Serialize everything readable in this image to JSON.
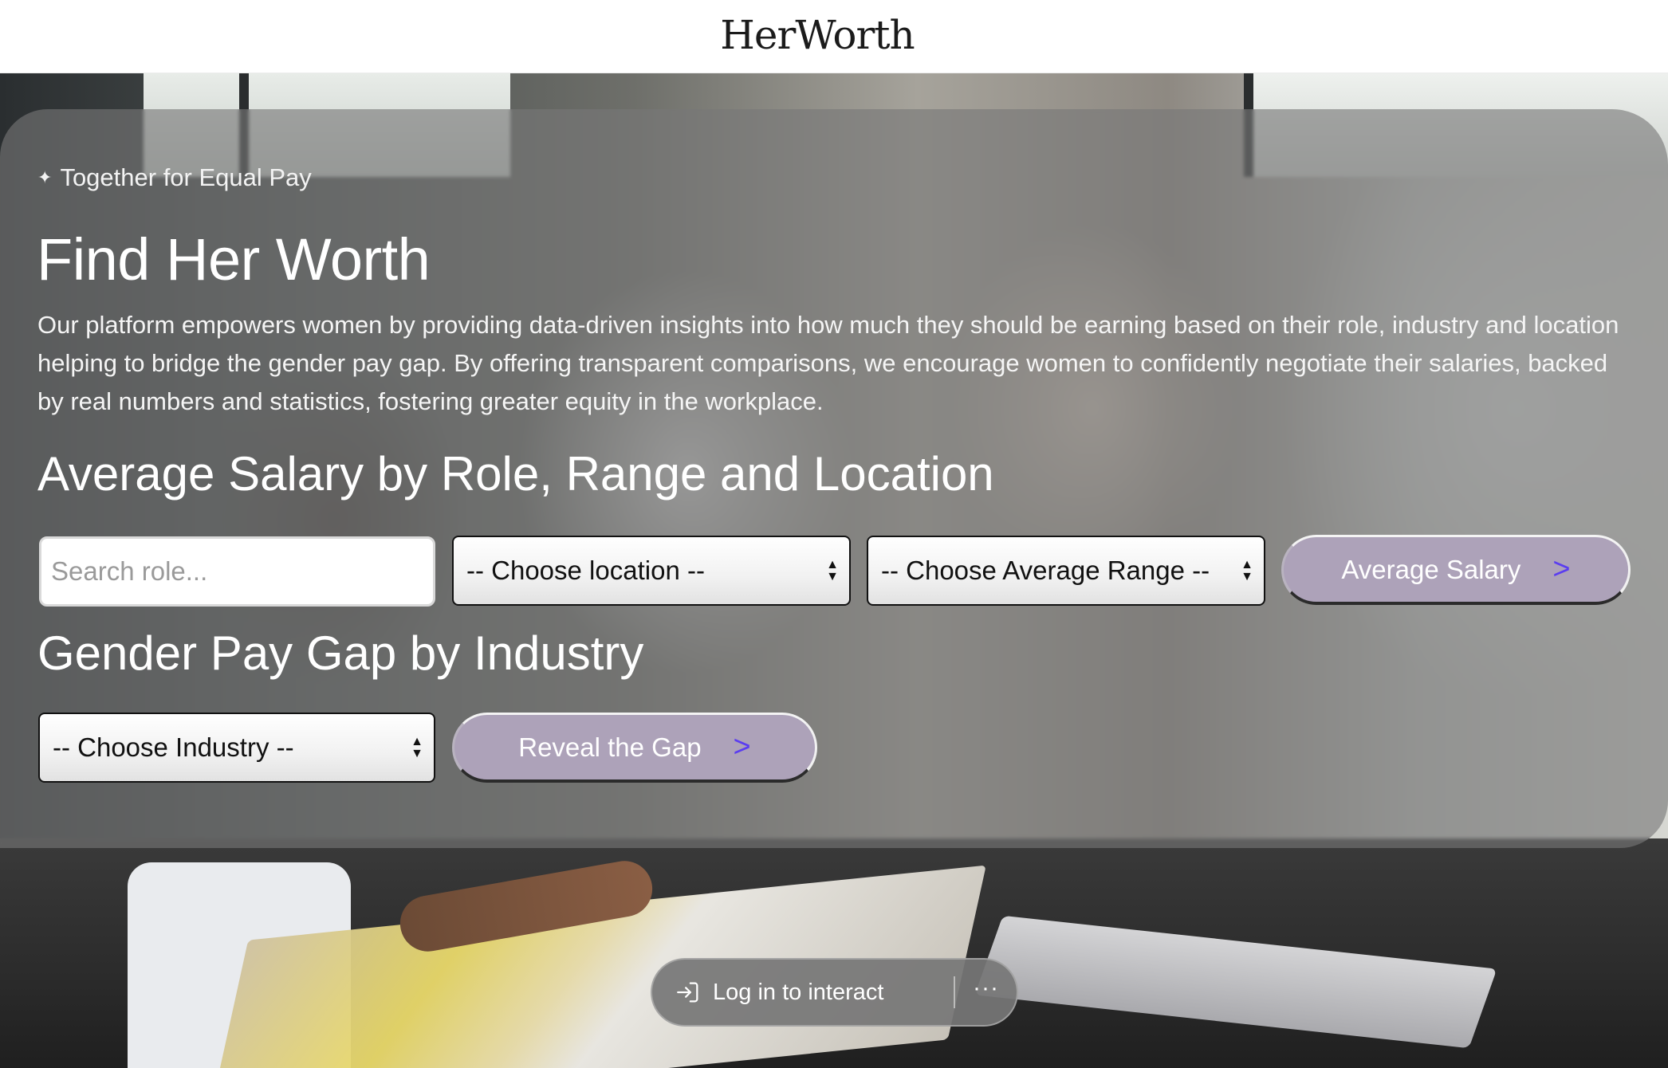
{
  "header": {
    "logo": "HerWorth"
  },
  "hero": {
    "tagline": "Together for Equal Pay",
    "tagline_icon": "sparkle-icon",
    "title": "Find Her Worth",
    "intro": "Our platform empowers women by providing data-driven insights into how much they should be earning based on their role, industry and location helping to bridge the gender pay gap. By offering transparent comparisons, we encourage women to confidently negotiate their salaries, backed by real numbers and statistics, fostering greater equity in the workplace."
  },
  "salary_section": {
    "heading": "Average Salary by Role, Range and Location",
    "search_placeholder": "Search role...",
    "location_select": "-- Choose location --",
    "range_select": "-- Choose Average Range --",
    "button_label": "Average Salary",
    "button_chevron": ">"
  },
  "gap_section": {
    "heading": "Gender Pay Gap by Industry",
    "industry_select": "-- Choose Industry --",
    "button_label": "Reveal the Gap",
    "button_chevron": ">"
  },
  "login_pill": {
    "label": "Log in to interact",
    "more": "···",
    "icon": "login-icon"
  },
  "colors": {
    "button_bg": "#ada2b9",
    "chevron": "#5b3df0",
    "hero_overlay": "rgba(120,120,120,0.62)"
  }
}
